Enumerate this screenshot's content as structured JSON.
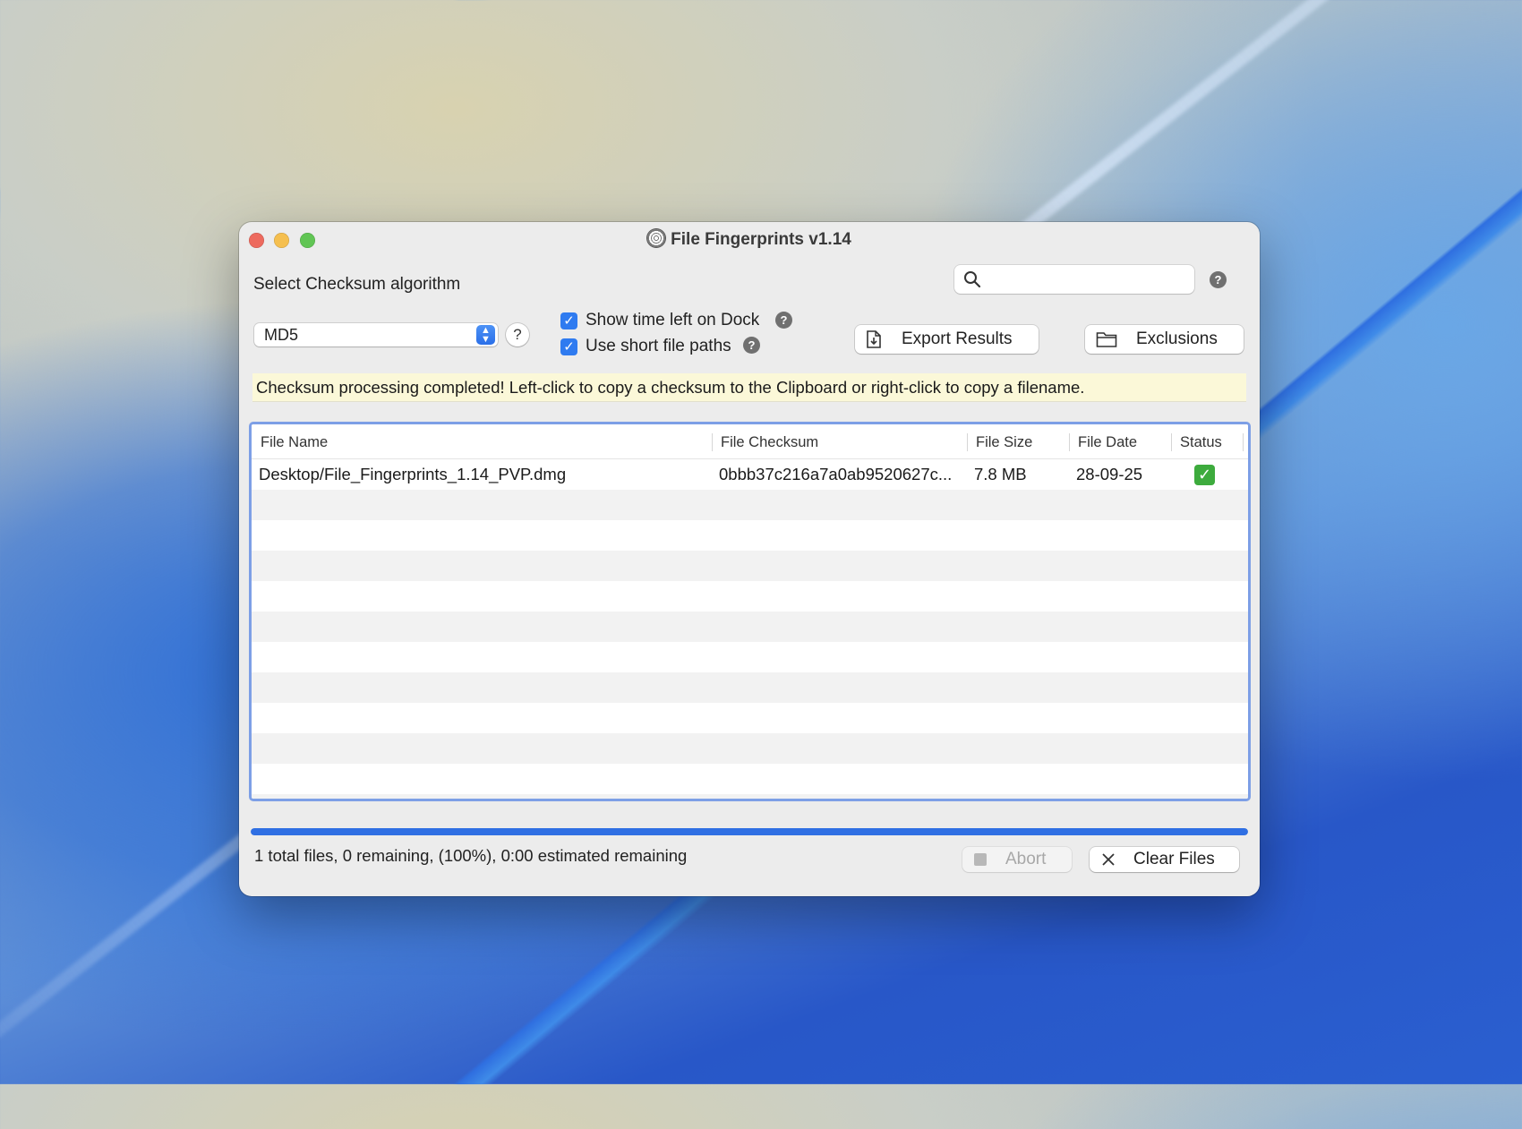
{
  "window": {
    "title": "File Fingerprints v1.14"
  },
  "algorithm": {
    "label": "Select Checksum algorithm",
    "selected": "MD5",
    "help": "?"
  },
  "options": {
    "show_time_left_label": "Show time left on Dock",
    "show_time_left_checked": true,
    "short_paths_label": "Use short file paths",
    "short_paths_checked": true,
    "help": "?"
  },
  "search": {
    "value": "",
    "placeholder": "",
    "help": "?"
  },
  "toolbar": {
    "export_label": "Export Results",
    "exclusions_label": "Exclusions"
  },
  "notice": "Checksum processing completed! Left-click to copy a checksum to the Clipboard or right-click to copy a filename.",
  "table": {
    "columns": [
      "File Name",
      "File Checksum",
      "File Size",
      "File Date",
      "Status"
    ],
    "rows": [
      {
        "file_name": "Desktop/File_Fingerprints_1.14_PVP.dmg",
        "checksum": "0bbb37c216a7a0ab9520627c...",
        "size": "7.8 MB",
        "date": "28-09-25",
        "status": "complete"
      }
    ]
  },
  "progress": {
    "percent": 100,
    "status_text": "1 total files, 0 remaining, (100%), 0:00 estimated remaining"
  },
  "footer": {
    "abort_label": "Abort",
    "clear_label": "Clear Files"
  },
  "colors": {
    "accent": "#2f6fe3",
    "notice_bg": "#fbf8d8",
    "status_ok": "#3dab3d"
  }
}
